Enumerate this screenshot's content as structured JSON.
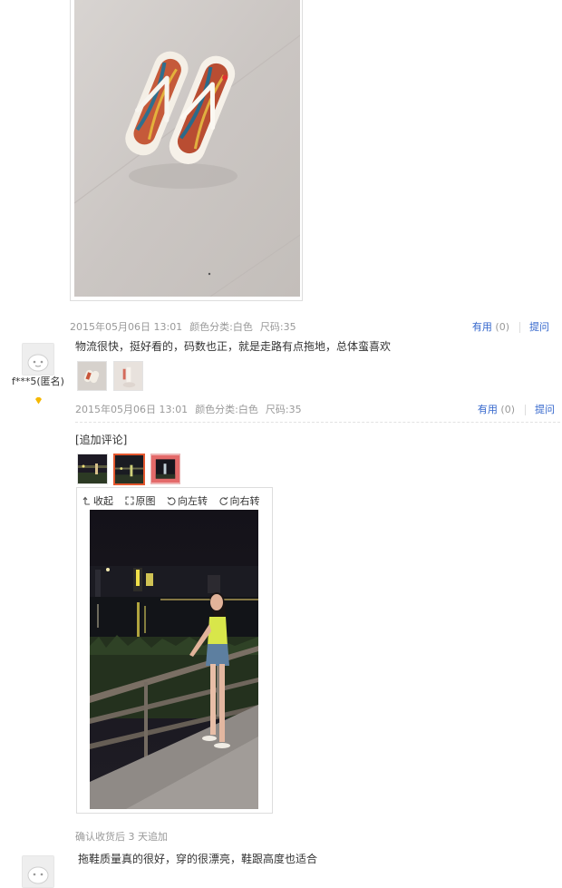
{
  "review1": {
    "date": "2015年05月06日 13:01",
    "color": "颜色分类:白色",
    "size": "尺码:35",
    "useful_label": "有用",
    "useful_count": "(0)",
    "ask_label": "提问"
  },
  "review2": {
    "username": "f***5(匿名)",
    "text": "物流很快，挺好看的，码数也正，就是走路有点拖地，总体蛮喜欢",
    "date": "2015年05月06日 13:01",
    "color": "颜色分类:白色",
    "size": "尺码:35",
    "useful_label": "有用",
    "useful_count": "(0)",
    "ask_label": "提问"
  },
  "followup": {
    "title": "[追加评论]",
    "toolbar": {
      "collapse": "收起",
      "original": "原图",
      "rotate_left": "向左转",
      "rotate_right": "向右转"
    },
    "note": "确认收货后 3 天追加"
  },
  "review3": {
    "text": "拖鞋质量真的很好，穿的很漂亮，鞋跟高度也适合"
  },
  "colors": {
    "link": "#3366cc",
    "selected_border": "#e4572e",
    "meta": "#999999"
  }
}
